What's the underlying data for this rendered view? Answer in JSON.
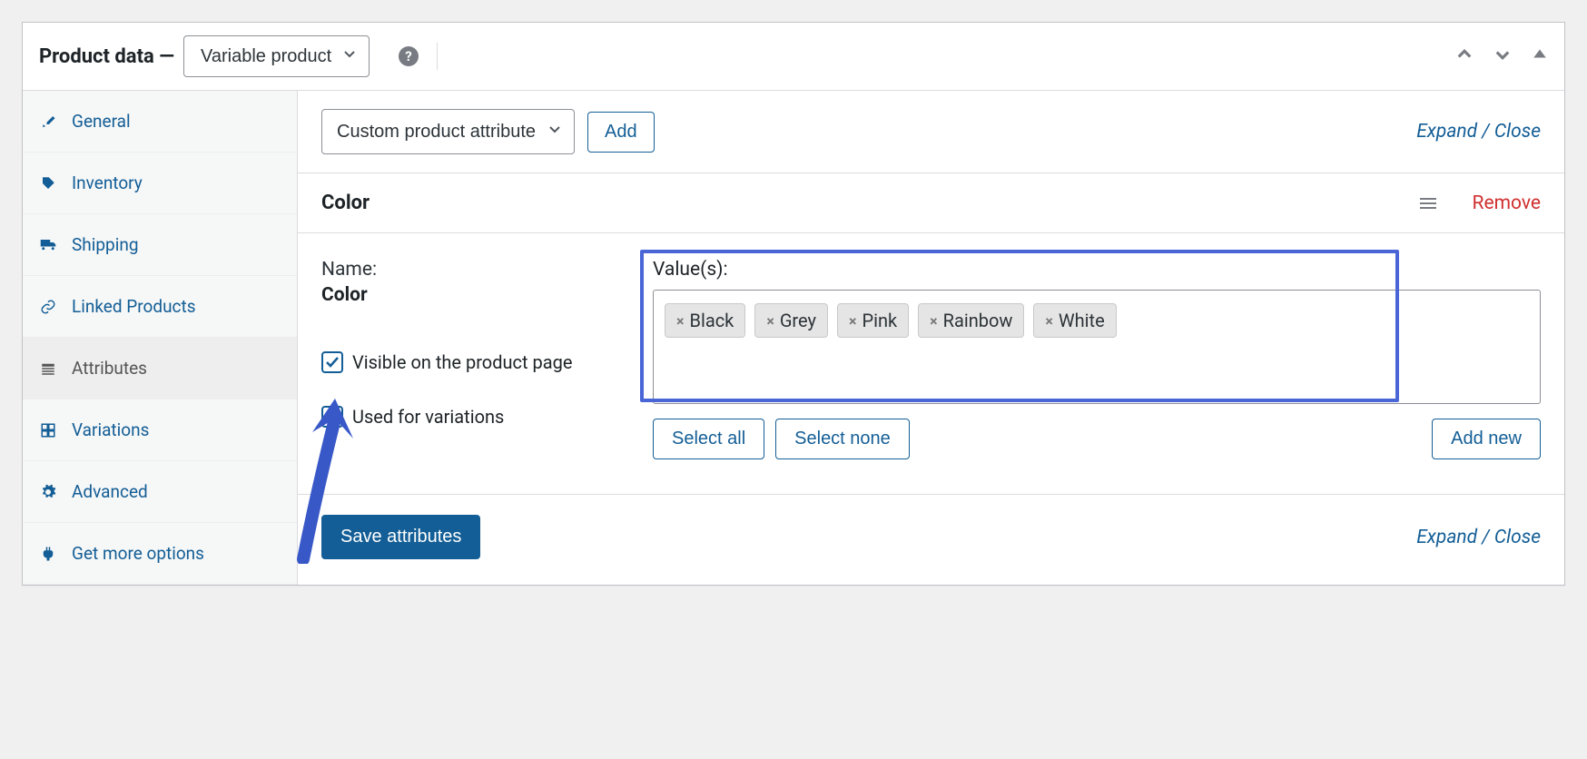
{
  "header": {
    "title": "Product data —",
    "product_type": "Variable product",
    "help": "?"
  },
  "sidebar": {
    "items": [
      {
        "label": "General"
      },
      {
        "label": "Inventory"
      },
      {
        "label": "Shipping"
      },
      {
        "label": "Linked Products"
      },
      {
        "label": "Attributes"
      },
      {
        "label": "Variations"
      },
      {
        "label": "Advanced"
      },
      {
        "label": "Get more options"
      }
    ]
  },
  "toolbar": {
    "attr_type": "Custom product attribute",
    "add_label": "Add",
    "expand_close": "Expand / Close"
  },
  "attribute": {
    "title": "Color",
    "remove_label": "Remove",
    "name_label": "Name:",
    "name_value": "Color",
    "visible_label": "Visible on the product page",
    "variations_label": "Used for variations",
    "values_label": "Value(s):",
    "values": [
      "Black",
      "Grey",
      "Pink",
      "Rainbow",
      "White"
    ],
    "select_all": "Select all",
    "select_none": "Select none",
    "add_new": "Add new"
  },
  "footer": {
    "save_label": "Save attributes",
    "expand_close": "Expand / Close"
  }
}
